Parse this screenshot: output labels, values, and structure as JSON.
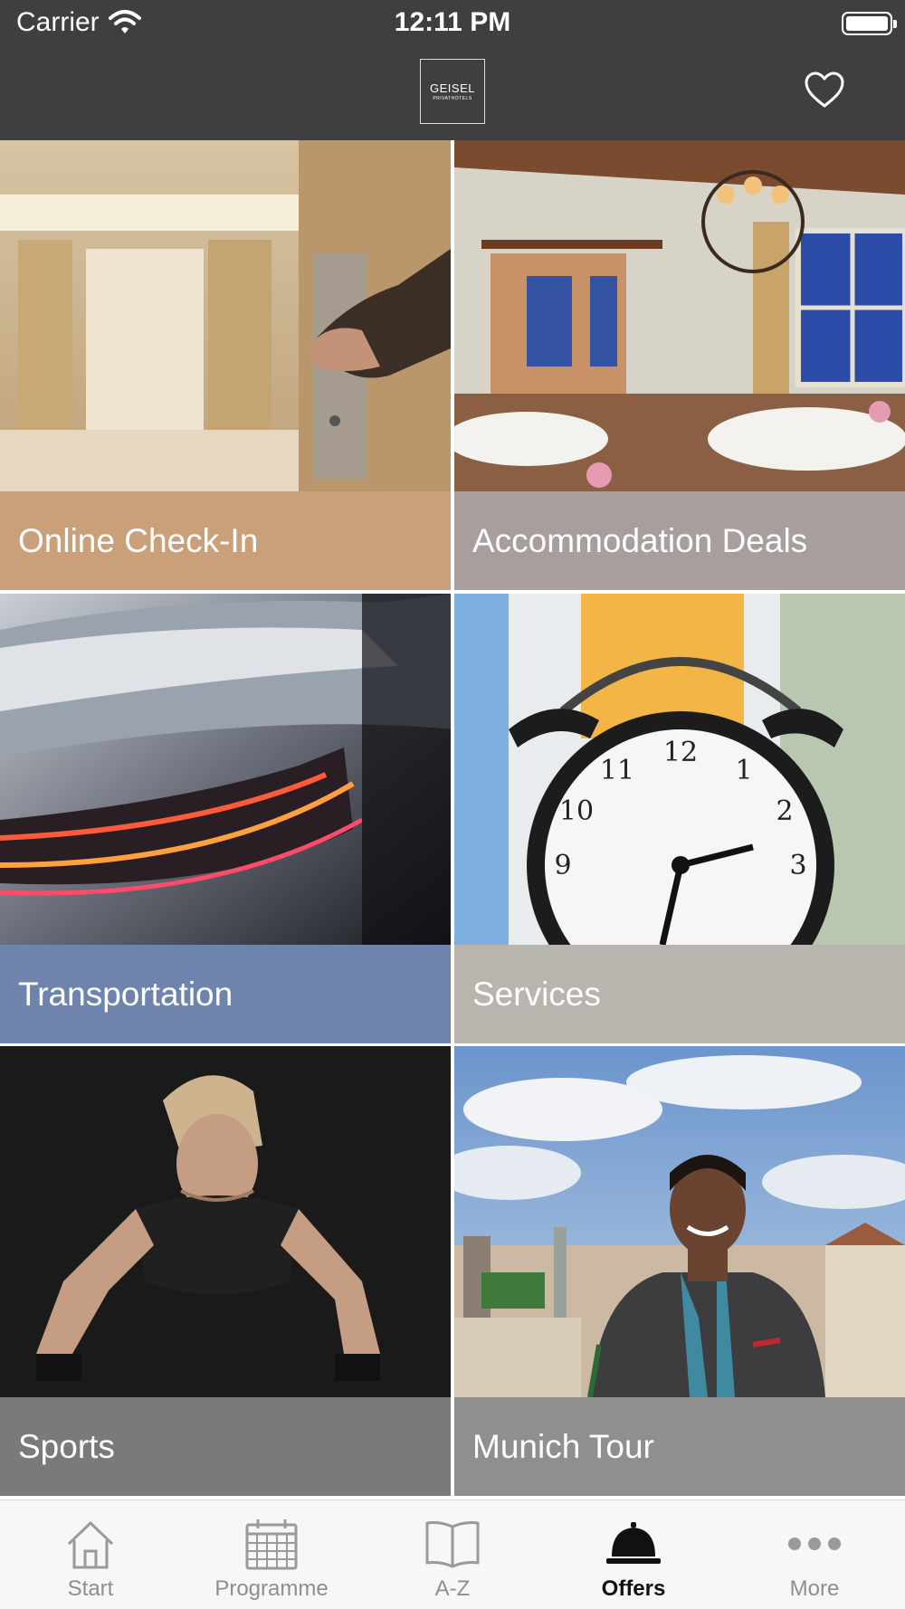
{
  "status_bar": {
    "carrier": "Carrier",
    "time": "12:11 PM"
  },
  "nav": {
    "logo_line1": "GEISEL",
    "logo_line2": "PRIVATHOTELS",
    "favorite_icon": "heart-icon"
  },
  "tiles": [
    {
      "label": "Online Check-In",
      "image": "hotel-door-keycard-photo",
      "bar_color": "#c9a07a"
    },
    {
      "label": "Accommodation Deals",
      "image": "restaurant-dining-room-photo",
      "bar_color": "#a79e9d"
    },
    {
      "label": "Transportation",
      "image": "car-taillight-photo",
      "bar_color": "#6f84ad"
    },
    {
      "label": "Services",
      "image": "alarm-clock-photo",
      "bar_color": "#b7b5ad"
    },
    {
      "label": "Sports",
      "image": "woman-pushup-photo",
      "bar_color": "#7a7a7a"
    },
    {
      "label": "Munich Tour",
      "image": "munich-guide-photo",
      "bar_color": "#8f8f90"
    }
  ],
  "tabbar": {
    "items": [
      {
        "label": "Start",
        "icon": "house-icon",
        "active": false
      },
      {
        "label": "Programme",
        "icon": "calendar-icon",
        "active": false
      },
      {
        "label": "A-Z",
        "icon": "book-icon",
        "active": false
      },
      {
        "label": "Offers",
        "icon": "service-bell-icon",
        "active": true
      },
      {
        "label": "More",
        "icon": "more-dots-icon",
        "active": false
      }
    ]
  }
}
